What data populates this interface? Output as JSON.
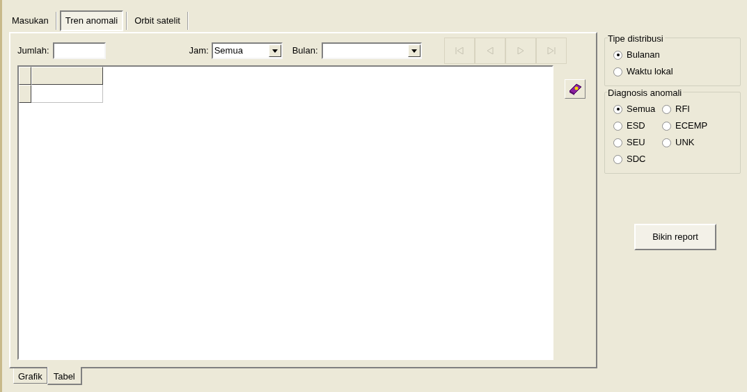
{
  "top_tabs": [
    {
      "label": "Masukan",
      "selected": false
    },
    {
      "label": "Tren anomali",
      "selected": true
    },
    {
      "label": "Orbit satelit",
      "selected": false
    }
  ],
  "toolbar": {
    "jumlah": {
      "label": "Jumlah:"
    },
    "jam": {
      "label": "Jam:",
      "value": "Semua"
    },
    "bulan": {
      "label": "Bulan:"
    },
    "nav_buttons": [
      {
        "kind": "first",
        "disabled": true
      },
      {
        "kind": "prev",
        "disabled": true
      },
      {
        "kind": "next",
        "disabled": true
      },
      {
        "kind": "last",
        "disabled": true
      }
    ]
  },
  "bottom_tabs": [
    {
      "label": "Grafik",
      "selected": false
    },
    {
      "label": "Tabel",
      "selected": true
    }
  ],
  "tipe_distribusi": {
    "title": "Tipe distribusi",
    "options": [
      {
        "label": "Bulanan",
        "selected": true
      },
      {
        "label": "Waktu lokal",
        "selected": false
      }
    ]
  },
  "diagnosis_anomali": {
    "title": "Diagnosis anomali",
    "options": [
      {
        "label": "Semua",
        "selected": true
      },
      {
        "label": "RFI",
        "selected": false
      },
      {
        "label": "ESD",
        "selected": false
      },
      {
        "label": "ECEMP",
        "selected": false
      },
      {
        "label": "SEU",
        "selected": false
      },
      {
        "label": "UNK",
        "selected": false
      },
      {
        "label": "SDC",
        "selected": false
      }
    ]
  },
  "report_button": "Bikin report"
}
